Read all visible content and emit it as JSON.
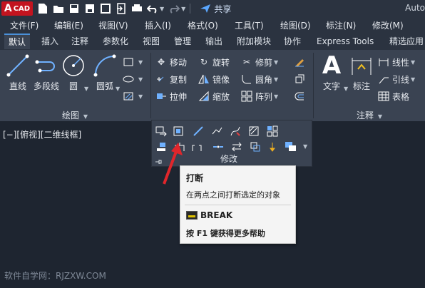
{
  "app": {
    "logo_main": "A",
    "logo_sub": "CAD",
    "share_label": "共享",
    "title": "Auto"
  },
  "menubar": {
    "items": [
      "文件(F)",
      "编辑(E)",
      "视图(V)",
      "插入(I)",
      "格式(O)",
      "工具(T)",
      "绘图(D)",
      "标注(N)",
      "修改(M)"
    ]
  },
  "tabs": {
    "items": [
      "默认",
      "插入",
      "注释",
      "参数化",
      "视图",
      "管理",
      "输出",
      "附加模块",
      "协作",
      "Express Tools",
      "精选应用"
    ],
    "active": "默认"
  },
  "draw_panel": {
    "line": "直线",
    "polyline": "多段线",
    "circle": "圆",
    "arc": "圆弧",
    "label": "绘图"
  },
  "modify_panel": {
    "move": "移动",
    "rotate": "旋转",
    "trim": "修剪",
    "copy": "复制",
    "mirror": "镜像",
    "fillet": "圆角",
    "stretch": "拉伸",
    "scale": "缩放",
    "array": "阵列",
    "label": "修改"
  },
  "annotation_panel": {
    "text": "文字",
    "dimension": "标注",
    "linear": "线性",
    "leader": "引线",
    "table": "表格",
    "label": "注释"
  },
  "viewport": {
    "label": "[−][俯视][二维线框]"
  },
  "tooltip": {
    "title": "打断",
    "description": "在两点之间打断选定的对象",
    "command": "BREAK",
    "help": "按 F1 键获得更多帮助"
  },
  "watermark": "软件自学网：RJZXW.COM",
  "colors": {
    "background": "#1e2530",
    "ribbon": "#3a4352",
    "accent": "#4a90d9",
    "logo": "#c3141f",
    "arrow": "#e0262b"
  }
}
